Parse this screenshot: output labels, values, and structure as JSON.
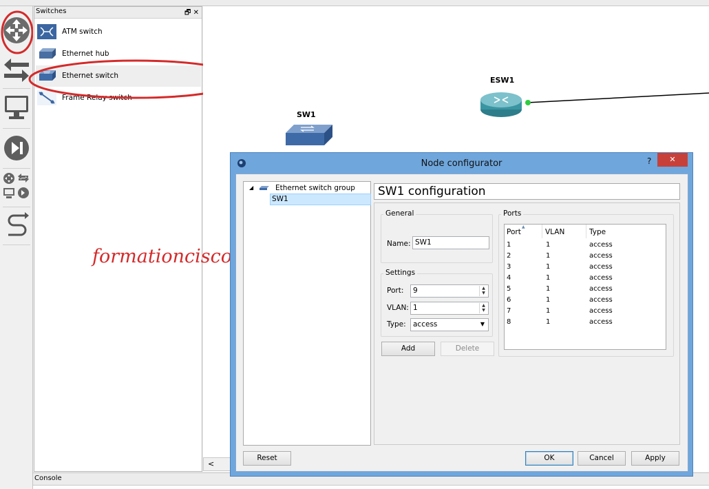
{
  "dock": {
    "title": "Switches",
    "items": [
      {
        "label": "ATM switch",
        "icon": "atm-switch-icon"
      },
      {
        "label": "Ethernet hub",
        "icon": "ethernet-hub-icon"
      },
      {
        "label": "Ethernet switch",
        "icon": "ethernet-switch-icon"
      },
      {
        "label": "Frame Relay switch",
        "icon": "frame-relay-switch-icon"
      }
    ]
  },
  "canvas": {
    "nodes": [
      {
        "label": "SW1",
        "icon": "ethernet-switch-icon"
      },
      {
        "label": "ESW1",
        "icon": "router-icon"
      }
    ],
    "watermark": "formationcisco.fr"
  },
  "console": {
    "title": "Console"
  },
  "dialog": {
    "title": "Node configurator",
    "help": "?",
    "close": "✕",
    "tree": {
      "group": "Ethernet switch group",
      "selected": "SW1"
    },
    "heading": "SW1 configuration",
    "general": {
      "title": "General",
      "name_label": "Name:",
      "name_value": "SW1"
    },
    "settings": {
      "title": "Settings",
      "port_label": "Port:",
      "port_value": "9",
      "vlan_label": "VLAN:",
      "vlan_value": "1",
      "type_label": "Type:",
      "type_value": "access"
    },
    "ports": {
      "title": "Ports",
      "columns": [
        "Port",
        "VLAN",
        "Type"
      ],
      "rows": [
        [
          "1",
          "1",
          "access"
        ],
        [
          "2",
          "1",
          "access"
        ],
        [
          "3",
          "1",
          "access"
        ],
        [
          "4",
          "1",
          "access"
        ],
        [
          "5",
          "1",
          "access"
        ],
        [
          "6",
          "1",
          "access"
        ],
        [
          "7",
          "1",
          "access"
        ],
        [
          "8",
          "1",
          "access"
        ]
      ]
    },
    "buttons": {
      "add": "Add",
      "delete": "Delete",
      "reset": "Reset",
      "ok": "OK",
      "cancel": "Cancel",
      "apply": "Apply"
    }
  },
  "colors": {
    "annotation": "#d42a2a",
    "dialog_frame": "#6fa6dc",
    "selection": "#cce8ff"
  }
}
